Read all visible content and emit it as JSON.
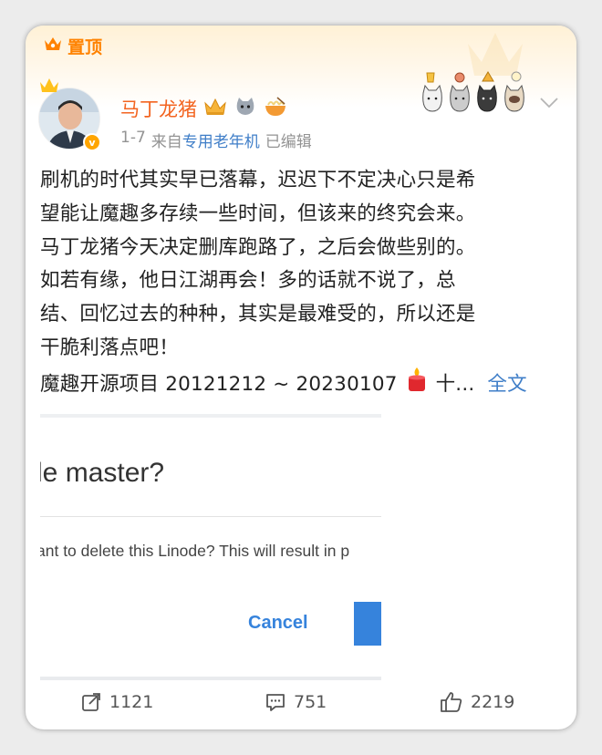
{
  "pinned": {
    "label": "置顶",
    "icon": "pin-icon"
  },
  "post": {
    "author": {
      "name": "马丁龙猪",
      "verified_mark": "v",
      "badges": [
        "crown-badge-icon",
        "cat-badge-icon",
        "noodle-badge-icon"
      ]
    },
    "date": "1-7",
    "source_prefix": "来自",
    "source_device": "专用老年机",
    "edited": "已编辑",
    "text_lines": [
      "刷机的时代其实早已落幕，迟迟下不定决心只是希",
      "望能让魔趣多存续一些时间，但该来的终究会来。",
      "马丁龙猪今天决定删库跑路了，之后会做些别的。",
      "如若有缘，他日江湖再会！多的话就不说了，总",
      "结、回忆过去的种种，其实是最难受的，所以还是",
      "干脆利落点吧！"
    ],
    "dates_line": "魔趣开源项目 20121212 ~ 20230107",
    "truncated": "十...",
    "full_text_link": "全文"
  },
  "embedded_screenshot": {
    "title": "de master?",
    "message": "ant to delete this Linode? This will result in p",
    "cancel_label": "Cancel"
  },
  "actions": {
    "share_count": "1121",
    "comment_count": "751",
    "like_count": "2219"
  },
  "colors": {
    "accent_orange": "#ff8200",
    "username": "#f36420",
    "link_blue": "#3f7ec8",
    "linode_blue": "#3683dc"
  }
}
